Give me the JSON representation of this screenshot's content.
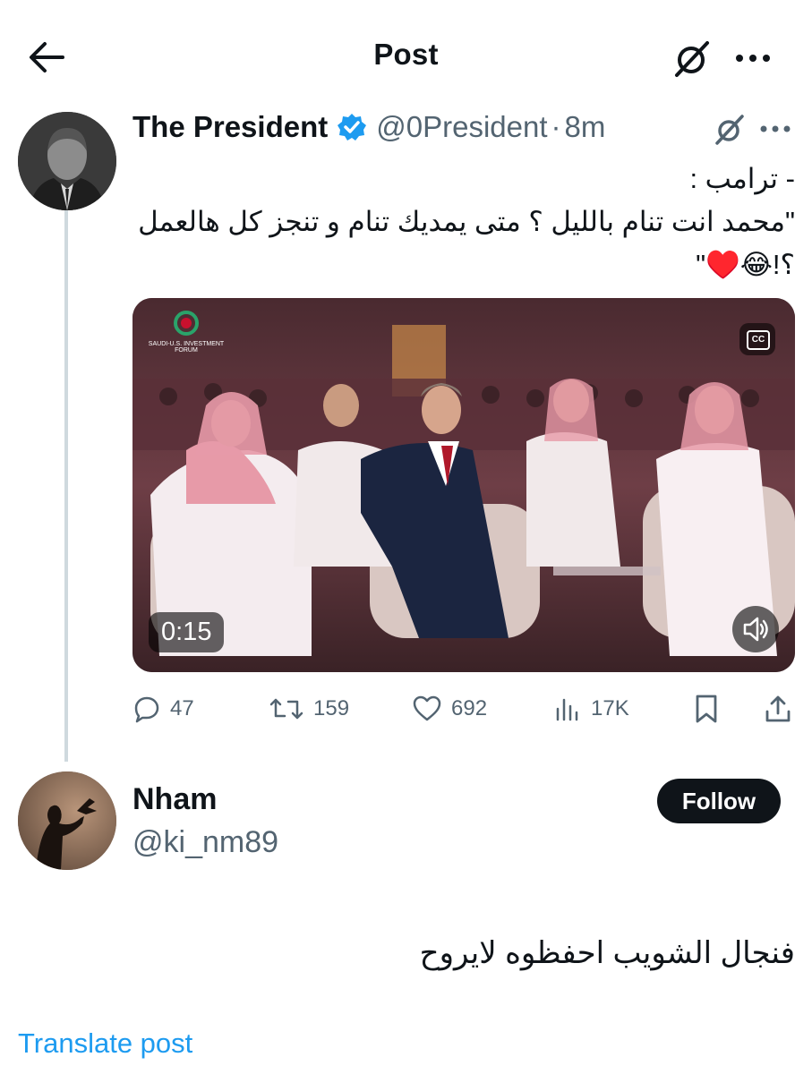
{
  "header": {
    "title": "Post"
  },
  "tweet": {
    "display_name": "The President",
    "handle": "@0President",
    "separator": "·",
    "time": "8m",
    "text": "- ترامب :\n\"محمد انت تنام بالليل ؟ متى يمديك تنام و تنجز كل هالعمل ؟!😂♥️\"",
    "media": {
      "duration": "0:15",
      "cc_label": "CC",
      "logo_caption": "SAUDI-U.S. INVESTMENT FORUM"
    },
    "actions": {
      "replies": "47",
      "reposts": "159",
      "likes": "692",
      "views": "17K"
    }
  },
  "reply": {
    "display_name": "Nham",
    "handle": "@ki_nm89",
    "follow_label": "Follow",
    "text": "فنجال الشويب احفظوه لايروح",
    "translate_label": "Translate post"
  },
  "colors": {
    "accent": "#1d9bf0",
    "text": "#0f1419",
    "secondary": "#536471",
    "thread_line": "#cfd9de"
  }
}
